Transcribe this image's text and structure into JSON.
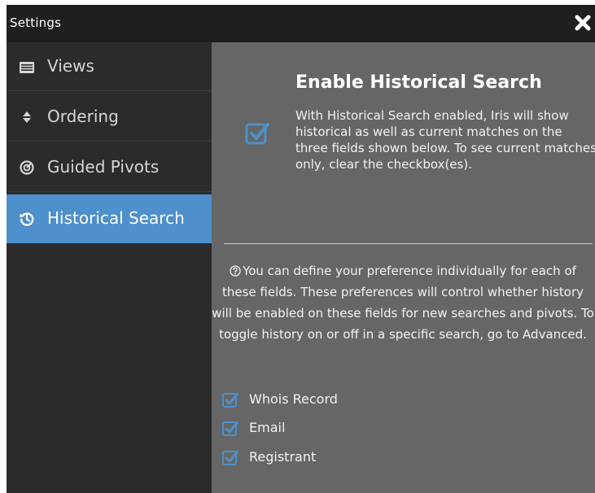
{
  "window": {
    "title": "Settings"
  },
  "colors": {
    "accent": "#4d90cb",
    "sidebar_bg": "#2b2b2b",
    "panel_bg": "#666666",
    "titlebar_bg": "#1f1f1f"
  },
  "sidebar": {
    "items": [
      {
        "label": "Views",
        "icon": "list-card-icon",
        "active": false
      },
      {
        "label": "Ordering",
        "icon": "sort-icon",
        "active": false
      },
      {
        "label": "Guided Pivots",
        "icon": "target-icon",
        "active": false
      },
      {
        "label": "Historical Search",
        "icon": "history-icon",
        "active": true
      }
    ]
  },
  "panel": {
    "heading": "Enable Historical Search",
    "enabled": true,
    "description": "With Historical Search enabled, Iris will show historical as well as current matches on the three fields shown below. To see current matches only, clear the checkbox(es).",
    "info": "You can define your preference individually for each of these fields. These preferences will control whether history will be enabled on these fields for new searches and pivots. To toggle history on or off in a specific search, go to Advanced.",
    "fields": [
      {
        "label": "Whois Record",
        "checked": true
      },
      {
        "label": "Email",
        "checked": true
      },
      {
        "label": "Registrant",
        "checked": true
      }
    ]
  }
}
